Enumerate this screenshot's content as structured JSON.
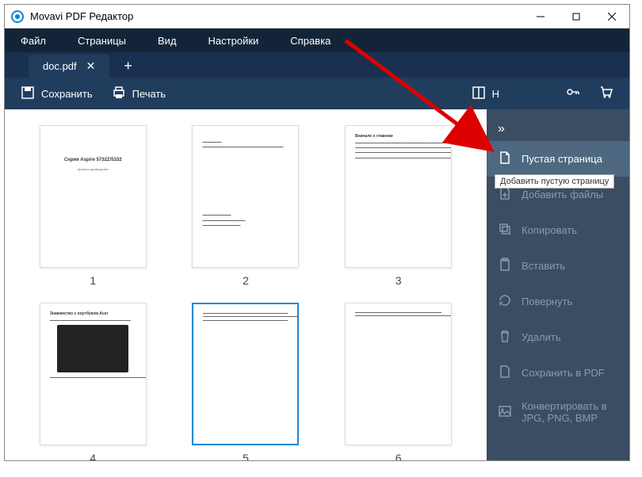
{
  "window": {
    "title": "Movavi PDF Редактор"
  },
  "menubar": {
    "file": "Файл",
    "pages": "Страницы",
    "view": "Вид",
    "settings": "Настройки",
    "help": "Справка"
  },
  "tabs": {
    "active": "doc.pdf"
  },
  "toolbar": {
    "save": "Сохранить",
    "print": "Печать",
    "hide": "Н"
  },
  "thumbnails": {
    "p1": {
      "num": "1",
      "title": "Серия Aspire 5732Z/5332",
      "sub": "Краткое руководство"
    },
    "p2": {
      "num": "2"
    },
    "p3": {
      "num": "3",
      "heading": "Вначале о главном"
    },
    "p4": {
      "num": "4",
      "heading": "Знакомство с ноутбуком Acer"
    },
    "p5": {
      "num": "5"
    },
    "p6": {
      "num": "6"
    }
  },
  "sidepanel": {
    "blank_page": "Пустая страница",
    "add_file": "Добавить файлы",
    "copy": "Копировать",
    "paste": "Вставить",
    "rotate": "Повернуть",
    "delete": "Удалить",
    "save_pdf": "Сохранить в PDF",
    "convert": "Конвертировать в JPG, PNG, BMP"
  },
  "tooltip": {
    "text": "Добавить пустую страницу"
  }
}
